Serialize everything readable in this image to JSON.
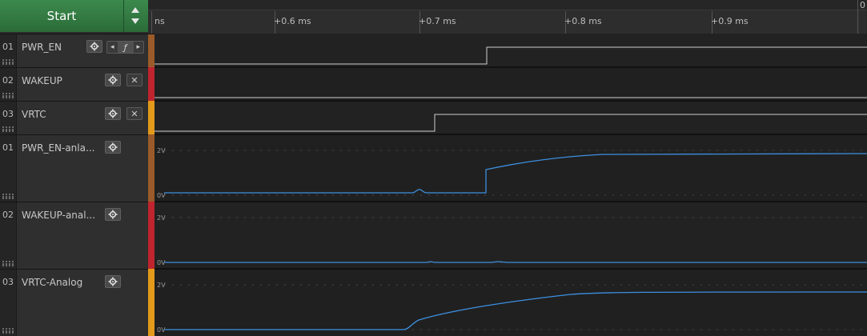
{
  "toolbar": {
    "start_label": "Start"
  },
  "ruler": {
    "left_partial": "ns",
    "right_partial": "0",
    "ticks": [
      "+0.6 ms",
      "+0.7 ms",
      "+0.8 ms",
      "+0.9 ms"
    ]
  },
  "channels": [
    {
      "num": "01",
      "name": "PWR_EN",
      "kind": "digital",
      "color": "#9a5a2a",
      "has_trigger": true
    },
    {
      "num": "02",
      "name": "WAKEUP",
      "kind": "digital",
      "color": "#c0242e",
      "has_close": true
    },
    {
      "num": "03",
      "name": "VRTC",
      "kind": "digital",
      "color": "#e39a1a",
      "has_close": true
    },
    {
      "num": "01",
      "name": "PWR_EN-anla...",
      "kind": "analog",
      "color": "#9a5a2a",
      "y_labels": [
        "2V",
        "0V"
      ]
    },
    {
      "num": "02",
      "name": "WAKEUP-anal...",
      "kind": "analog",
      "color": "#c0242e",
      "y_labels": [
        "2V",
        "0V"
      ]
    },
    {
      "num": "03",
      "name": "VRTC-Analog",
      "kind": "analog",
      "color": "#e39a1a",
      "y_labels": [
        "2V",
        "0V"
      ]
    }
  ],
  "trigger": {
    "left": "◂",
    "edge": "ƒ",
    "right": "▸"
  },
  "close_icon": "✕",
  "colors": {
    "trace": "#3d8fe0",
    "digital": "#cfcfcf",
    "accent_green": "#3c8a4c"
  }
}
